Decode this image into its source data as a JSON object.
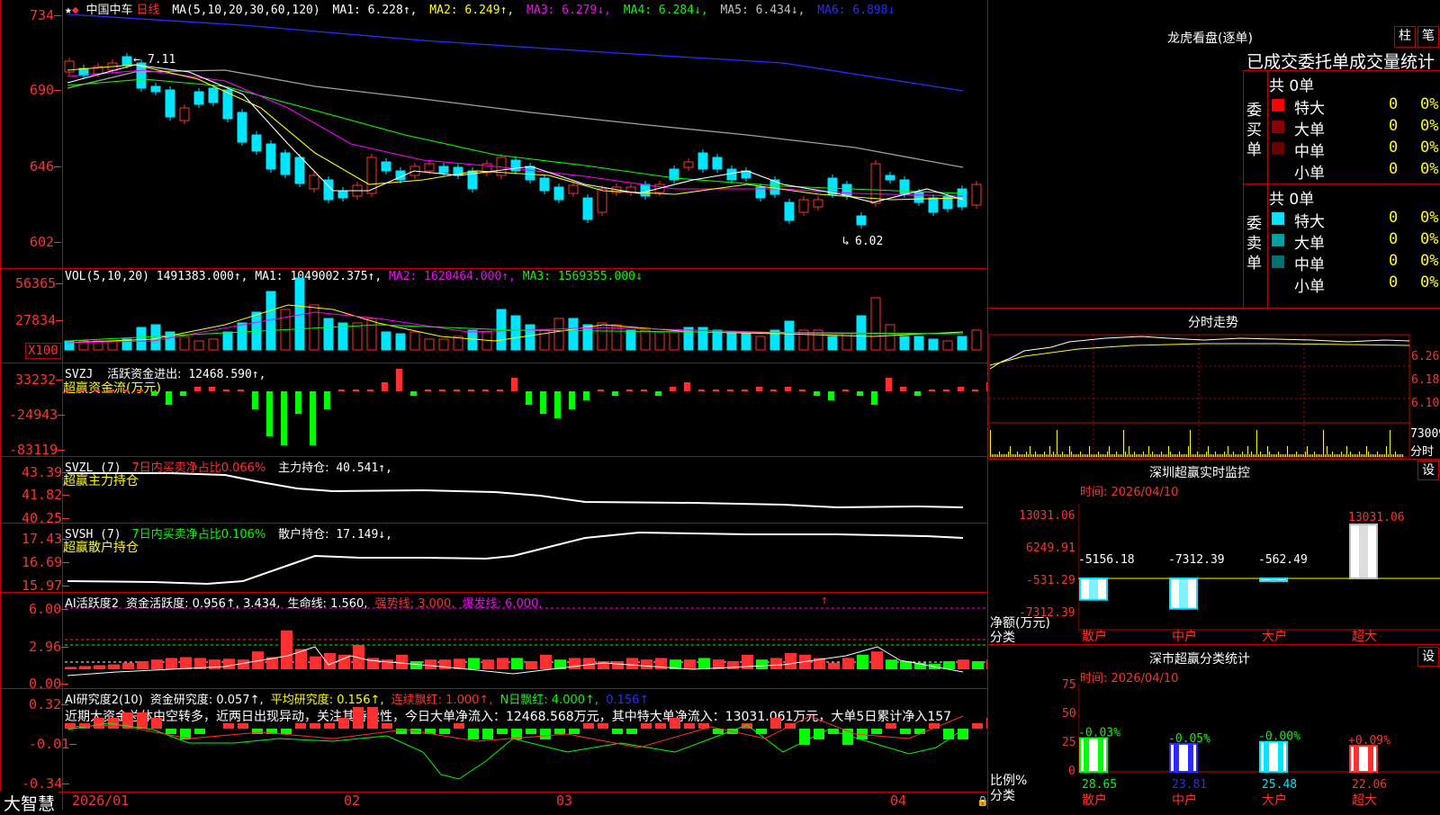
{
  "app": {
    "brand": "大智慧",
    "stock_name": "中国中车",
    "period": "日线"
  },
  "colors": {
    "up": "#ff3030",
    "down": "#00e5ff",
    "green": "#00ff00",
    "yellow": "#ffff00",
    "magenta": "#ff00ff",
    "blue": "#2b2bff",
    "axis": "#c00000"
  },
  "price_panel": {
    "header": {
      "ma_params": "MA(5,10,20,30,60,120)",
      "ma1": "MA1: 6.228↑,",
      "ma2": "MA2: 6.249↑,",
      "ma3": "MA3: 6.279↓,",
      "ma4": "MA4: 6.284↓,",
      "ma5": "MA5: 6.434↓,",
      "ma6": "MA6: 6.898↓"
    },
    "y_labels": [
      "734",
      "690",
      "646",
      "602"
    ],
    "high_marker": "7.11",
    "low_marker": "6.02"
  },
  "vol_panel": {
    "header": {
      "name": "VOL(5,10,20)",
      "value": "1491383.000↑,",
      "ma1": "MA1: 1049002.375↑,",
      "ma2": "MA2: 1620464.000↑,",
      "ma3": "MA3: 1569355.000↓"
    },
    "y_labels": [
      "56365",
      "27834"
    ],
    "unit": "X100"
  },
  "svzj_panel": {
    "header": {
      "name": "SVZJ",
      "label": "活跃资金进出:",
      "value": "12468.590↑,",
      "line2": "超赢资金流(万元)"
    },
    "y_labels": [
      "33232",
      "-24943",
      "-83119"
    ]
  },
  "svzl_panel": {
    "header": {
      "name": "SVZL (7)",
      "ratio": "7日内买卖净占比0.066%",
      "label": "主力持仓:",
      "value": "40.541↑,",
      "line2": "超赢主力持仓"
    },
    "y_labels": [
      "43.39",
      "41.82",
      "40.25"
    ]
  },
  "svsh_panel": {
    "header": {
      "name": "SVSH (7)",
      "ratio": "7日内买卖净占比0.106%",
      "label": "散户持仓:",
      "value": "17.149↓,",
      "line2": "超赢散户持仓"
    },
    "y_labels": [
      "17.43",
      "16.69",
      "15.97"
    ]
  },
  "ai_activity_panel": {
    "header": {
      "name": "AI活跃度2",
      "label": "资金活跃度:",
      "v1": "0.956↑,",
      "v2": "3.434,",
      "life_label": "生命线:",
      "life": "1.560,",
      "strong": "强势线: 3.000,",
      "burst": "爆发线: 6.000,"
    },
    "y_labels": [
      "6.00",
      "2.96",
      "0.00"
    ]
  },
  "ai_research_panel": {
    "header": {
      "name": "AI研究度2(10)",
      "label": "资金研究度:",
      "v1": "0.057↑,",
      "avg": "平均研究度: 0.156↑,",
      "lianxu": "连续飘红: 1.000↑,",
      "nri": "N日飘红: 4.000↑,",
      "last": "0.156↑"
    },
    "comment": "近期大资金总体由空转多，近两日出现异动，关注其持续性，今日大单净流入：12468.568万元，其中特大单净流入：13031.061万元，大单5日累计净入157",
    "y_labels": [
      "0.32",
      "-0.01",
      "-0.34"
    ]
  },
  "x_axis": {
    "labels": [
      "2026/01",
      "02",
      "03",
      "04"
    ]
  },
  "dragon_tiger": {
    "title": "龙虎看盘(逐单)",
    "btn1": "柱",
    "btn2": "笔",
    "subtitle": "已成交委托单成交量统计",
    "buy": {
      "side": "委买单",
      "total": "共 0单",
      "rows": [
        {
          "label": "特大",
          "v": "0",
          "p": "0%"
        },
        {
          "label": "大单",
          "v": "0",
          "p": "0%"
        },
        {
          "label": "中单",
          "v": "0",
          "p": "0%"
        },
        {
          "label": "小单",
          "v": "0",
          "p": "0%"
        }
      ]
    },
    "sell": {
      "side": "委卖单",
      "total": "共 0单",
      "rows": [
        {
          "label": "特大",
          "v": "0",
          "p": "0%"
        },
        {
          "label": "大单",
          "v": "0",
          "p": "0%"
        },
        {
          "label": "中单",
          "v": "0",
          "p": "0%"
        },
        {
          "label": "小单",
          "v": "0",
          "p": "0%"
        }
      ]
    }
  },
  "intraday": {
    "title": "分时走势",
    "y_labels": [
      "6.26",
      "6.18",
      "6.10"
    ],
    "vol_label": "73009",
    "footer": "分时"
  },
  "sz_monitor": {
    "title": "深圳超赢实时监控",
    "set": "设",
    "time": "时间: 2026/04/10",
    "y_labels": [
      "13031.06",
      "6249.91",
      "-531.29",
      "-7312.39"
    ],
    "axis_title": "净额(万元)",
    "axis_title2": "分类",
    "bars": [
      {
        "label": "散户",
        "value": "-5156.18"
      },
      {
        "label": "中户",
        "value": "-7312.39"
      },
      {
        "label": "大户",
        "value": "-562.49"
      },
      {
        "label": "超大",
        "value": "13031.06"
      }
    ]
  },
  "sz_class": {
    "title": "深市超赢分类统计",
    "set": "设",
    "time": "时间: 2026/04/10",
    "y_labels": [
      "75",
      "50",
      "25",
      "0"
    ],
    "axis_title": "比例%",
    "axis_title2": "分类",
    "bars": [
      {
        "label": "散户",
        "value": "28.65",
        "delta": "-0.03%"
      },
      {
        "label": "中户",
        "value": "23.81",
        "delta": "-0.05%"
      },
      {
        "label": "大户",
        "value": "25.48",
        "delta": "-0.00%"
      },
      {
        "label": "超大",
        "value": "22.06",
        "delta": "+0.09%"
      }
    ]
  }
}
